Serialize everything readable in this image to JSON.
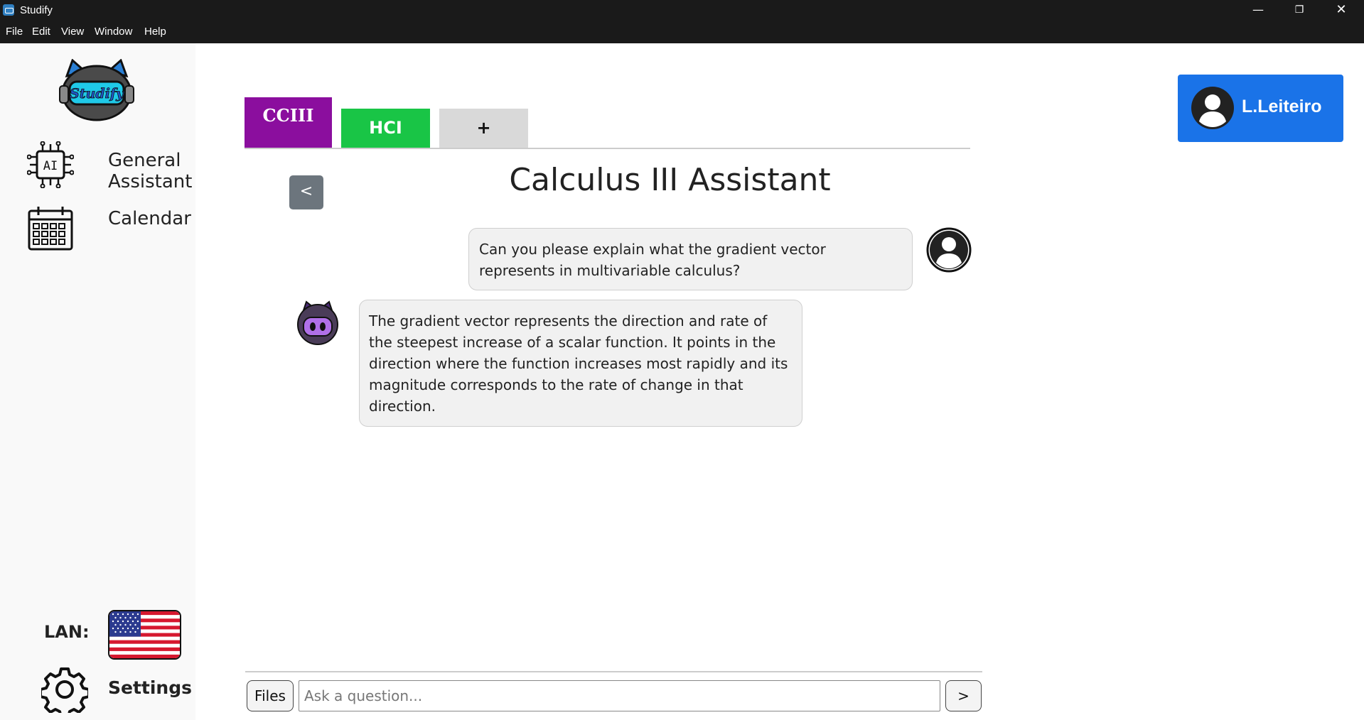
{
  "window": {
    "title": "Studify",
    "minimize_glyph": "—",
    "maximize_glyph": "❐",
    "close_glyph": "✕"
  },
  "menu": {
    "items": [
      "File",
      "Edit",
      "View",
      "Window",
      "Help"
    ]
  },
  "sidebar": {
    "logo_text": "Studify",
    "items": [
      {
        "label_line1": "General",
        "label_line2": "Assistant",
        "icon": "ai-chip-icon"
      },
      {
        "label": "Calendar",
        "icon": "calendar-icon"
      }
    ],
    "language_label": "LAN:",
    "language_flag": "us-flag-icon",
    "settings_label": "Settings"
  },
  "tabs": [
    {
      "label": "CCIII",
      "color": "#8b0e9e",
      "active": true
    },
    {
      "label": "HCI",
      "color": "#19c546",
      "active": false
    },
    {
      "label": "+",
      "color": "#d9d9d9",
      "active": false
    }
  ],
  "profile": {
    "name": "L.Leiteiro",
    "color": "#1a73e8"
  },
  "main": {
    "back_label": "<",
    "title": "Calculus III Assistant",
    "messages": [
      {
        "role": "user",
        "text": "Can you please explain what the gradient vector represents in multivariable calculus?"
      },
      {
        "role": "assistant",
        "text": "The gradient vector represents the direction and rate of the steepest increase of a scalar function. It points in the direction where the function increases most rapidly and its magnitude corresponds to the rate of change in that direction."
      }
    ]
  },
  "input": {
    "files_label": "Files",
    "placeholder": "Ask a question...",
    "value": "",
    "send_label": ">"
  }
}
